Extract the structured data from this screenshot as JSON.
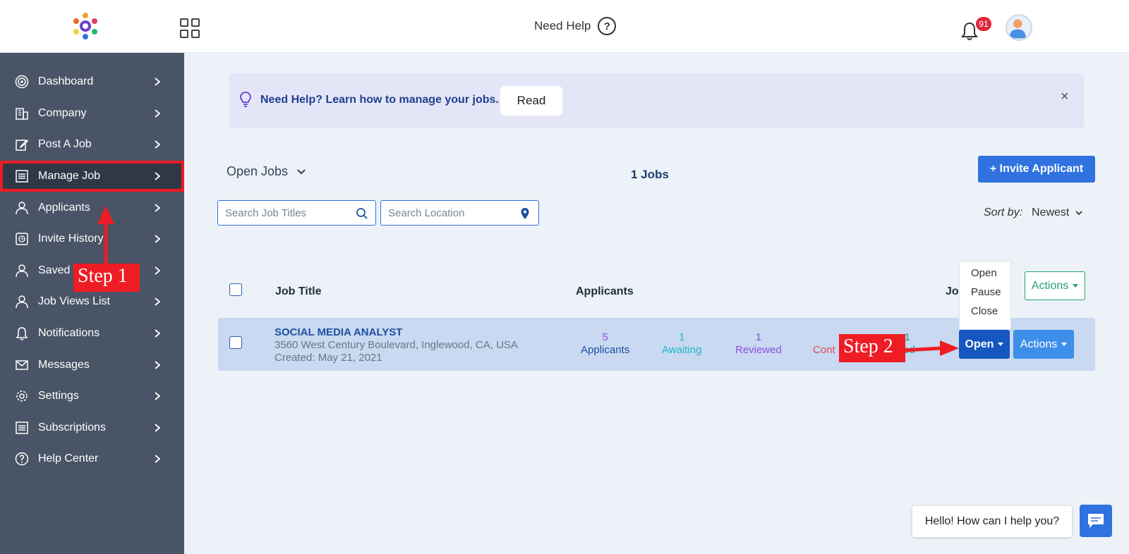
{
  "header": {
    "need_help_label": "Need Help",
    "help_icon_glyph": "?",
    "notification_count": "91"
  },
  "sidebar": {
    "items": [
      {
        "label": "Dashboard",
        "icon": "dashboard-icon"
      },
      {
        "label": "Company",
        "icon": "building-icon"
      },
      {
        "label": "Post A Job",
        "icon": "edit-icon"
      },
      {
        "label": "Manage Job",
        "icon": "list-icon",
        "active": true
      },
      {
        "label": "Applicants",
        "icon": "user-icon"
      },
      {
        "label": "Invite History",
        "icon": "history-icon"
      },
      {
        "label": "Saved C",
        "icon": "user-icon"
      },
      {
        "label": "Job Views List",
        "icon": "user-icon"
      },
      {
        "label": "Notifications",
        "icon": "bell-icon"
      },
      {
        "label": "Messages",
        "icon": "mail-icon"
      },
      {
        "label": "Settings",
        "icon": "gear-icon"
      },
      {
        "label": "Subscriptions",
        "icon": "list-icon"
      },
      {
        "label": "Help Center",
        "icon": "help-icon"
      }
    ]
  },
  "annotations": {
    "step1": "Step 1",
    "step2": "Step 2",
    "color": "#ee1c24"
  },
  "banner": {
    "text": "Need Help? Learn how to manage your jobs.",
    "read_label": "Read",
    "close_glyph": "×"
  },
  "jobs": {
    "filter_label": "Open Jobs",
    "count_label": "1 Jobs",
    "invite_label": "+ Invite Applicant",
    "search_title_placeholder": "Search Job Titles",
    "search_location_placeholder": "Search Location",
    "sort_label": "Sort by:",
    "sort_value": "Newest"
  },
  "table": {
    "headers": {
      "job_title": "Job Title",
      "applicants": "Applicants",
      "job_status_partial": "Job",
      "actions": "Actions"
    },
    "rows": [
      {
        "title": "SOCIAL MEDIA ANALYST",
        "address": "3560 West Century Boulevard, Inglewood, CA, USA",
        "created": "Created: May 21, 2021",
        "stats": [
          {
            "count": "5",
            "label": "Applicants",
            "color": "#1f4f9f"
          },
          {
            "count": "1",
            "label": "Awaiting",
            "color": "#20b5c8"
          },
          {
            "count": "1",
            "label": "Reviewed",
            "color": "#8a4fe0"
          },
          {
            "count": "",
            "label": "Cont",
            "color": "#e8485a"
          },
          {
            "count": "1",
            "label": "red",
            "color": "#21a07a"
          }
        ],
        "status": "Open",
        "actions_label": "Actions"
      }
    ],
    "status_options": [
      "Open",
      "Pause",
      "Close"
    ]
  },
  "chat": {
    "greeting": "Hello! How can I help you?"
  },
  "colors": {
    "sidebar_bg": "#495466",
    "primary": "#2f72e0",
    "open_button": "#1557c0",
    "row_highlight": "#c8d9f1"
  }
}
